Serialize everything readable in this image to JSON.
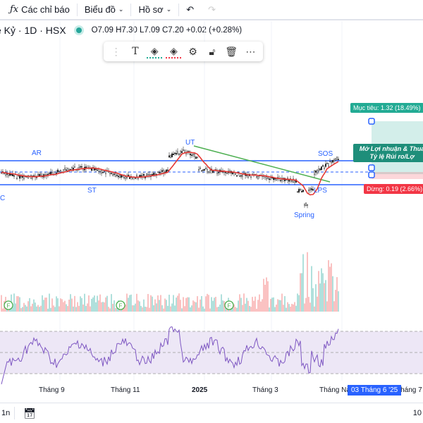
{
  "toolbar": {
    "indicators": "Các chỉ báo",
    "chart": "Biểu đồ",
    "profile": "Hồ sơ"
  },
  "legend": {
    "symbol": "ề Kỷ · 1D · HSX",
    "ohlc": "O7.09 H7.30 L7.09 C7.20 +0.02 (+0.28%)"
  },
  "drawing_toolbar": [
    "drag-handle",
    "text",
    "fill-color",
    "line-color",
    "settings",
    "unlock",
    "delete",
    "more"
  ],
  "annotations": [
    "AR",
    "ST",
    "UT",
    "SOS",
    "LPS",
    "Spring",
    "C"
  ],
  "position_tool": {
    "target": "Mục tiêu: 1.32 (18.49%)",
    "open_pl": "Mở Lợi nhuận & Thua",
    "ratio": "Tỷ lệ Rủi ro/Lợ",
    "stop": "Dừng: 0.19 (2.66%)"
  },
  "time_axis": [
    "Tháng 9",
    "Tháng 11",
    "2025",
    "Tháng 3",
    "Tháng Nă",
    "Tháng 7"
  ],
  "crosshair_date": "03 Tháng 6 '25",
  "bottom": {
    "range": "1n",
    "right": "10"
  },
  "colors": {
    "up": "#26a69a",
    "down": "#ef5350",
    "level": "#2962ff",
    "rsi": "#7e57c2",
    "target": "#22ab94",
    "stop": "#f23645"
  }
}
